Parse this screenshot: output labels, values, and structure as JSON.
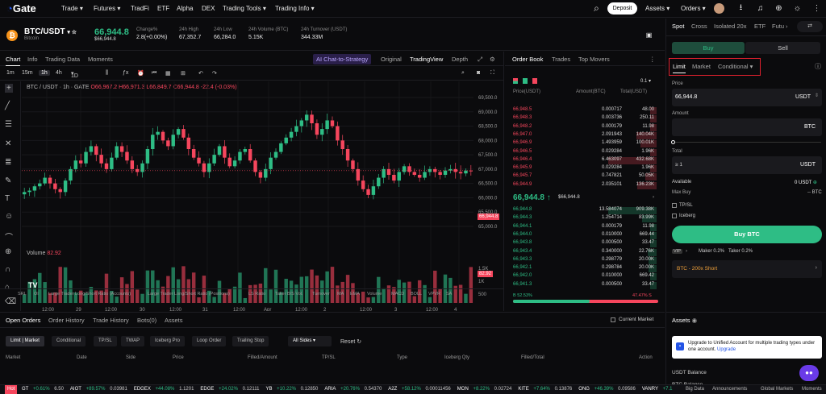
{
  "nav": {
    "logo": "Gate",
    "items": [
      "Trade",
      "Futures",
      "TradFi",
      "ETF",
      "Alpha",
      "DEX",
      "Trading Tools",
      "Trading Info"
    ],
    "deposit": "Deposit",
    "assets": "Assets",
    "orders": "Orders"
  },
  "ticker": {
    "pair": "BTC/USDT",
    "coin": "Bitcoin",
    "price": "66,944.8",
    "price_usd": "$66,944.8",
    "stats": [
      {
        "label": "Change%",
        "value": "2.8(+0.00%)"
      },
      {
        "label": "24h High",
        "value": "67,352.7"
      },
      {
        "label": "24h Low",
        "value": "66,284.0"
      },
      {
        "label": "24h Volume (BTC)",
        "value": "5.15K"
      },
      {
        "label": "24h Turnover (USDT)",
        "value": "344.33M"
      }
    ]
  },
  "chart_tabs": {
    "items": [
      "Chart",
      "Info",
      "Trading Data",
      "Moments"
    ],
    "ai": "AI Chat-to-Strategy",
    "original": "Original",
    "tradingview": "TradingView",
    "depth": "Depth"
  },
  "intervals": [
    "1m",
    "15m",
    "1h",
    "4h",
    "1D"
  ],
  "chart_label": {
    "title": "BTC / USDT · 1h · GATE",
    "o": "O66,967.2",
    "h": "H66,971.3",
    "l": "L66,849.7",
    "c": "C66,944.8",
    "chg": "-22.4 (-0.03%)",
    "volume": "Volume",
    "volume_val": "82.92",
    "last": "66,944.8",
    "vol_last": "82.92"
  },
  "chart_data": {
    "type": "candlestick",
    "ylim": [
      65000,
      69500
    ],
    "y_ticks": [
      "69,500.0",
      "69,000.0",
      "68,500.0",
      "68,000.0",
      "67,500.0",
      "67,000.0",
      "66,500.0",
      "66,000.0",
      "65,500.0",
      "65,000.0"
    ],
    "x_ticks": [
      "12:00",
      "29",
      "12:00",
      "30",
      "12:00",
      "31",
      "12:00",
      "Apr",
      "12:00",
      "2",
      "12:00",
      "3",
      "12:00",
      "4"
    ],
    "vol_ticks": [
      "1.5K",
      "1K",
      "500"
    ]
  },
  "indicators": [
    "SRL",
    "OI",
    "Large Trader Long/Short Ratio (Accounts)",
    "Large Trader Long/Short Ratio (Positions)",
    "LS Ratio",
    "Taker B/S Vol.",
    "Turnover",
    "MA",
    "EMA",
    "Volume",
    "MACD",
    "BOLL",
    "VPVR",
    "SA"
  ],
  "orderbook": {
    "tabs": [
      "Order Book",
      "Trades",
      "Top Movers"
    ],
    "step": "0.1",
    "headers": [
      "Price(USDT)",
      "Amount(BTC)",
      "Total(USDT)"
    ],
    "asks": [
      [
        "66,948.5",
        "0.000717",
        "48.00"
      ],
      [
        "66,948.3",
        "0.003736",
        "250.11"
      ],
      [
        "66,948.2",
        "0.000179",
        "11.98"
      ],
      [
        "66,947.0",
        "2.091943",
        "140.04K"
      ],
      [
        "66,946.9",
        "1.493959",
        "100.01K"
      ],
      [
        "66,946.5",
        "0.029284",
        "1.96K"
      ],
      [
        "66,946.4",
        "6.463097",
        "432.68K"
      ],
      [
        "66,945.9",
        "0.029284",
        "1.96K"
      ],
      [
        "66,945.7",
        "0.747821",
        "50.05K"
      ],
      [
        "66,944.9",
        "2.035101",
        "136.23K"
      ]
    ],
    "mid": "66,944.8",
    "mid_usd": "$66,944.8",
    "bids": [
      [
        "66,944.8",
        "13.584074",
        "909.38K"
      ],
      [
        "66,944.3",
        "1.254714",
        "83.99K"
      ],
      [
        "66,944.1",
        "0.000179",
        "11.98"
      ],
      [
        "66,944.0",
        "0.010000",
        "669.44"
      ],
      [
        "66,943.8",
        "0.000500",
        "33.47"
      ],
      [
        "66,943.4",
        "0.340000",
        "22.76K"
      ],
      [
        "66,943.3",
        "0.298779",
        "20.00K"
      ],
      [
        "66,942.1",
        "0.298784",
        "20.00K"
      ],
      [
        "66,942.0",
        "0.010000",
        "669.42"
      ],
      [
        "66,941.3",
        "0.000500",
        "33.47"
      ]
    ],
    "buy_ratio": "B 52.53%",
    "sell_ratio": "47.47% S"
  },
  "trade": {
    "tabs": [
      "Spot",
      "Cross",
      "Isolated 20x",
      "ETF",
      "Futu"
    ],
    "buy": "Buy",
    "sell": "Sell",
    "order_types": [
      "Limit",
      "Market",
      "Conditional"
    ],
    "price_label": "Price",
    "price_value": "66,944.8",
    "unit": "USDT",
    "amount_label": "Amount",
    "amount_unit": "BTC",
    "total_label": "Total",
    "total_placeholder": "≥ 1",
    "total_unit": "USDT",
    "available_label": "Available",
    "available_value": "0 USDT",
    "max_buy_label": "Max Buy",
    "max_buy_value": "-- BTC",
    "tpsl": "TP/SL",
    "iceberg": "Iceberg",
    "buy_button": "Buy BTC",
    "vip": "VIP",
    "maker": "Maker 0.2%",
    "taker": "Taker 0.2%",
    "promo": "BTC - 200x Short"
  },
  "bottom": {
    "tabs": [
      "Open Orders",
      "Order History",
      "Trade History",
      "Bots(0)",
      "Assets"
    ],
    "current_market": "Current Market",
    "subtabs": [
      "Limit | Market",
      "Conditional",
      "TP/SL",
      "TWAP",
      "Iceberg Pro",
      "Loop Order",
      "Trailing Stop"
    ],
    "sides": "All Sides",
    "reset": "Reset",
    "columns": [
      "Market",
      "Date",
      "Side",
      "Price",
      "Filled/Amount",
      "TP/SL",
      "Type",
      "Iceberg Qty",
      "Filled/Total",
      "Action"
    ]
  },
  "assets": {
    "title": "Assets",
    "notice": "Upgrade to Unified Account for multiple trading types under one account.",
    "upgrade": "Upgrade",
    "usdt_balance": "USDT Balance",
    "btc_balance": "BTC Balance"
  },
  "marquee": {
    "hot": "Hot",
    "items": [
      [
        "GT",
        "+0.61%",
        "6.50"
      ],
      [
        "AIOT",
        "+89.57%",
        "0.03981"
      ],
      [
        "EDGEX",
        "+44.08%",
        "1.1201"
      ],
      [
        "EDGE",
        "+24.02%",
        "0.12111"
      ],
      [
        "YB",
        "+10.22%",
        "0.12850"
      ],
      [
        "ARIA",
        "+20.76%",
        "0.54370"
      ],
      [
        "A2Z",
        "+58.12%",
        "0.00011456"
      ],
      [
        "MON",
        "+8.22%",
        "0.02724"
      ],
      [
        "KITE",
        "+7.64%",
        "0.13876"
      ],
      [
        "ONG",
        "+46.39%",
        "0.09586"
      ],
      [
        "VANRY",
        "+7.1",
        ""
      ]
    ],
    "links": [
      "Big Data",
      "Announcements",
      "Global Markets",
      "Moments"
    ]
  }
}
